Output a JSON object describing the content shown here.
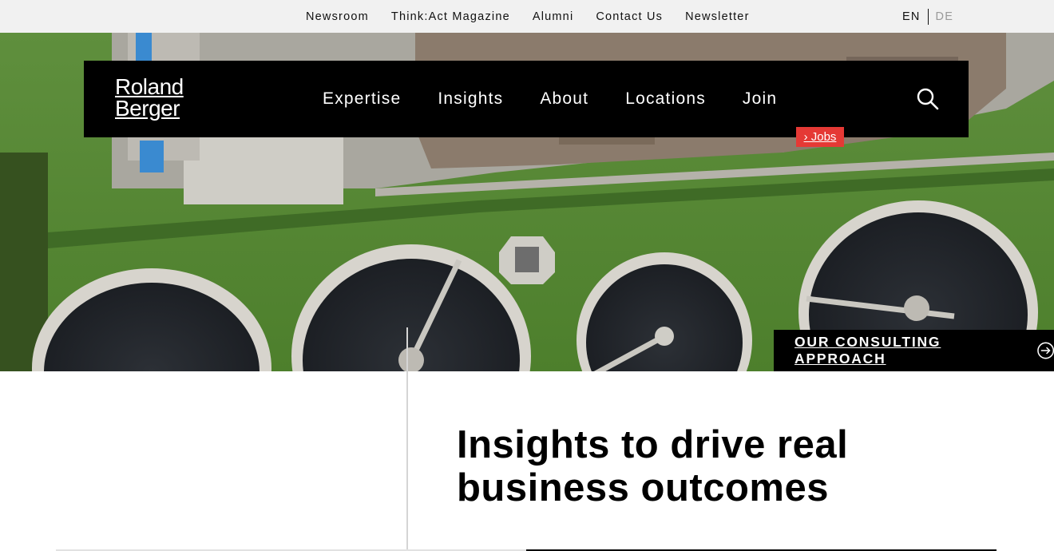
{
  "utility": {
    "links": [
      "Newsroom",
      "Think:Act Magazine",
      "Alumni",
      "Contact Us",
      "Newsletter"
    ],
    "lang_active": "EN",
    "lang_other": "DE"
  },
  "nav": {
    "logo_line1": "Roland",
    "logo_line2": "Berger",
    "items": [
      "Expertise",
      "Insights",
      "About",
      "Locations",
      "Join"
    ],
    "jobs_label": "› Jobs"
  },
  "hero": {
    "cta_label": "OUR CONSULTING APPROACH"
  },
  "content": {
    "headline": "Insights to drive real business outcomes"
  },
  "colors": {
    "accent_red": "#e53935",
    "nav_black": "#000000",
    "utility_bg": "#f1f1f1"
  },
  "icons": {
    "search": "search-icon",
    "cta": "arrow-circle-right-icon"
  }
}
